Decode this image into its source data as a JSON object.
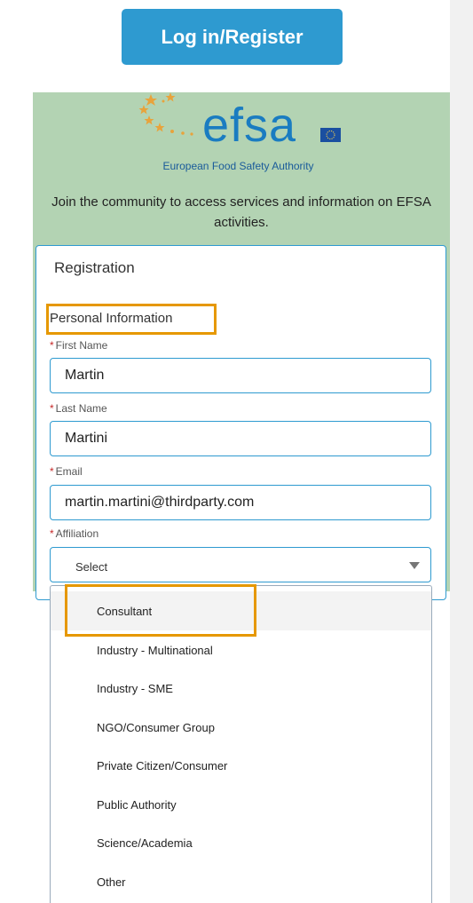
{
  "header": {
    "login_label": "Log in/Register"
  },
  "logo": {
    "wordmark": "efsa",
    "subtitle": "European Food Safety Authority",
    "star_color": "#e8a33c",
    "brand_color": "#1a7cc1"
  },
  "intro_text": "Join the community to access services and information on EFSA activities.",
  "form": {
    "title": "Registration",
    "section": "Personal Information",
    "required_marker": "*",
    "first_name": {
      "label": "First Name",
      "value": "Martin"
    },
    "last_name": {
      "label": "Last Name",
      "value": "Martini"
    },
    "email": {
      "label": "Email",
      "value": "martin.martini@thirdparty.com"
    },
    "affiliation": {
      "label": "Affiliation",
      "value": "Select",
      "options": [
        "Consultant",
        "Industry - Multinational",
        "Industry - SME",
        "NGO/Consumer Group",
        "Private Citizen/Consumer",
        "Public Authority",
        "Science/Academia",
        "Other"
      ]
    }
  },
  "colors": {
    "accent": "#2e9ad0",
    "panel": "#b3d3b3",
    "highlight": "#e69800",
    "required": "#c62828"
  }
}
